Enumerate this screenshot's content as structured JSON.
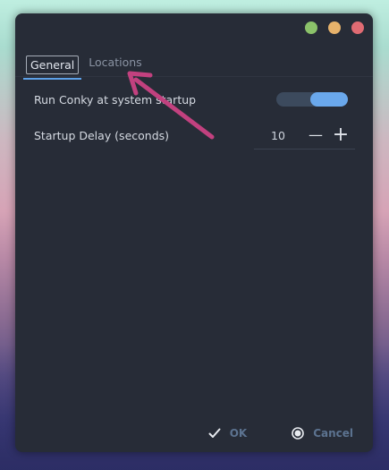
{
  "tabs": [
    {
      "label": "General",
      "active": true
    },
    {
      "label": "Locations",
      "active": false
    }
  ],
  "settings": {
    "startup_label": "Run Conky at system startup",
    "startup_enabled": true,
    "delay_label": "Startup Delay (seconds)",
    "delay_value": "10",
    "decrement_symbol": "—",
    "increment_symbol": "+"
  },
  "footer": {
    "ok_label": "OK",
    "cancel_label": "Cancel",
    "ok_icon": "checkmark-icon",
    "cancel_icon": "radio-cancel-icon"
  },
  "window_controls": [
    "maximize",
    "minimize",
    "close"
  ],
  "colors": {
    "accent": "#6aa8ec",
    "window_bg": "#272c37",
    "annotation_arrow": "#c2417f"
  }
}
